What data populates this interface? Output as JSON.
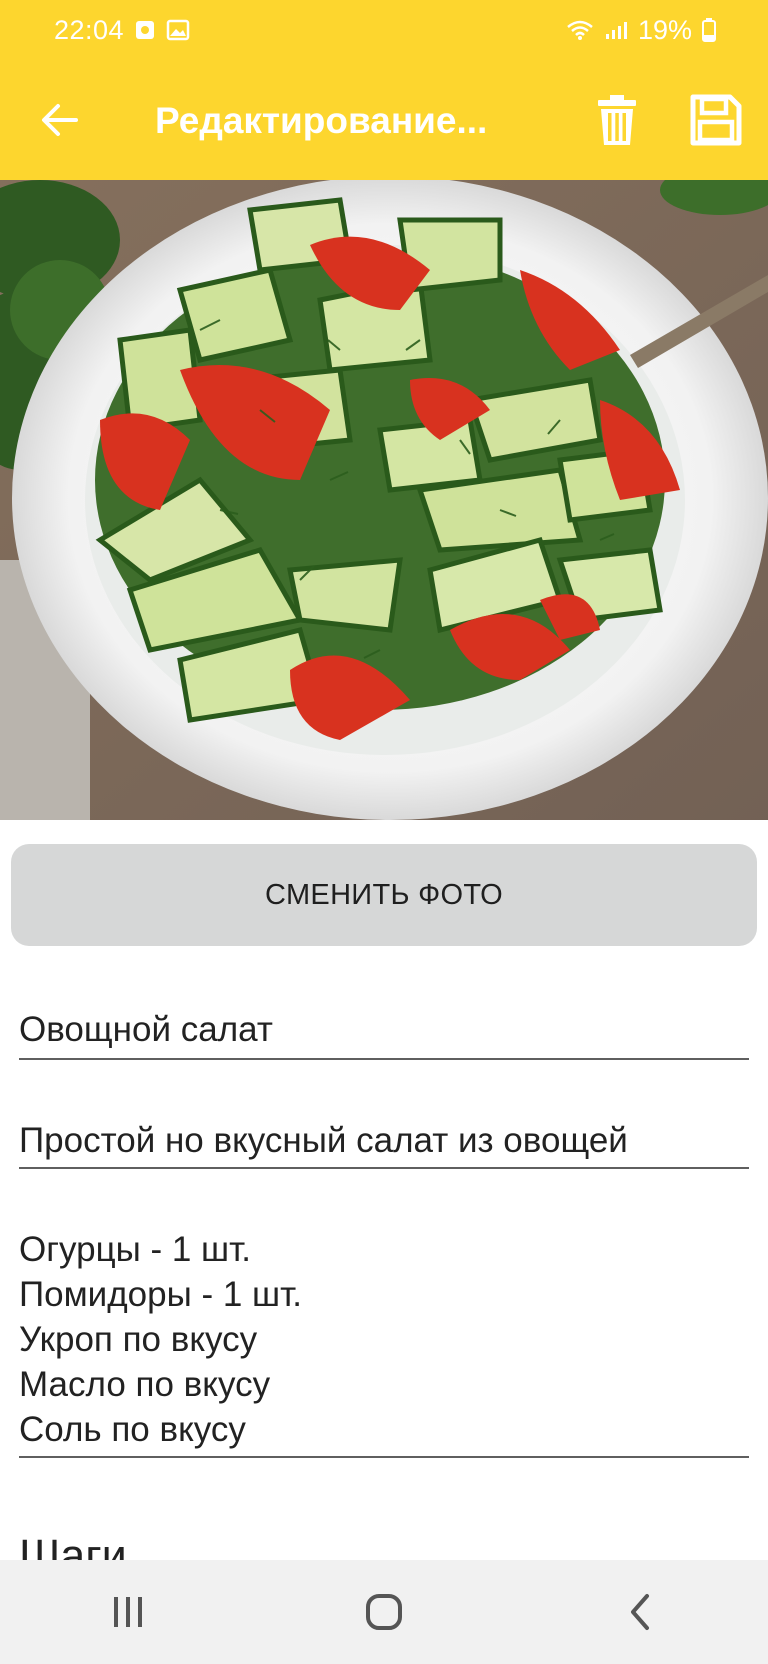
{
  "status_bar": {
    "time": "22:04",
    "battery": "19%"
  },
  "app_bar": {
    "title": "Редактирование..."
  },
  "photo": {
    "description_icon": "salad-photo"
  },
  "buttons": {
    "change_photo": "СМЕНИТЬ ФОТО"
  },
  "form": {
    "title": "Овощной салат",
    "description": "Простой но вкусный салат из овощей",
    "ingredients": [
      "Огурцы - 1 шт.",
      "Помидоры - 1 шт.",
      "Укроп по вкусу",
      "Масло по вкусу",
      "Соль по вкусу"
    ]
  },
  "steps_heading": "Шаги",
  "colors": {
    "accent": "#FDD62E",
    "button_bg": "#D6D7D7",
    "nav_bg": "#F1F1F1"
  }
}
